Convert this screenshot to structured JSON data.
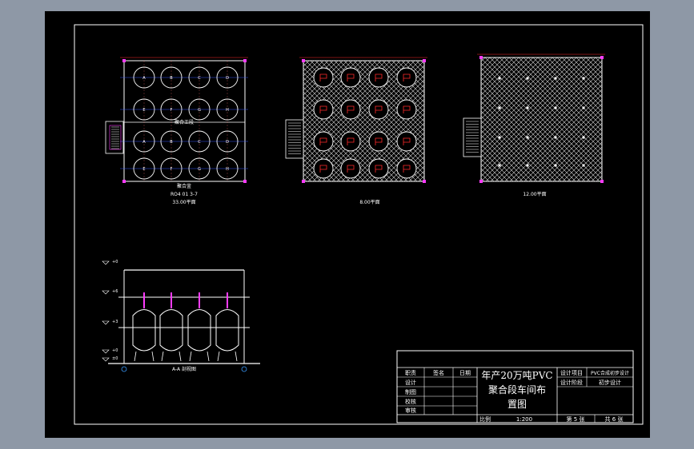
{
  "drawing": {
    "plans": {
      "plan1": {
        "caption": "33.00平面",
        "subcaption": "RO4 01 3-7",
        "center_label": "聚合工段",
        "bottom_label": "聚合釜",
        "vessels": [
          "A",
          "B",
          "C",
          "D",
          "E",
          "F",
          "G",
          "H",
          "A",
          "B",
          "C",
          "D",
          "E",
          "F",
          "G",
          "H"
        ]
      },
      "plan2": {
        "caption": "8.00平面"
      },
      "plan3": {
        "caption": "12.00平面"
      }
    },
    "section": {
      "caption": "A-A 剖视图",
      "levels": [
        "+0",
        "+6",
        "+3",
        "+0",
        "±0"
      ]
    },
    "title_block": {
      "title_line1": "年产20万吨PVC",
      "title_line2": "聚合段车间布",
      "title_line3": "置图",
      "col_headers": [
        "职责",
        "签名",
        "日期"
      ],
      "rows": [
        "设计",
        "制图",
        "校核",
        "审核"
      ],
      "right_labels": [
        "设计项目",
        "设计阶段"
      ],
      "right_values": [
        "PVC合成初步设计",
        "初步设计"
      ],
      "scale_label": "比例",
      "scale_value": "1:200",
      "sheet_label": "第 5 张",
      "total_label": "共 6 张"
    },
    "colors": {
      "background": "#000000",
      "frame": "#8e98a6",
      "line": "#ffffff",
      "axis": "#3a5bff",
      "dim": "#ff2a2a",
      "node": "#ff3cff"
    }
  }
}
